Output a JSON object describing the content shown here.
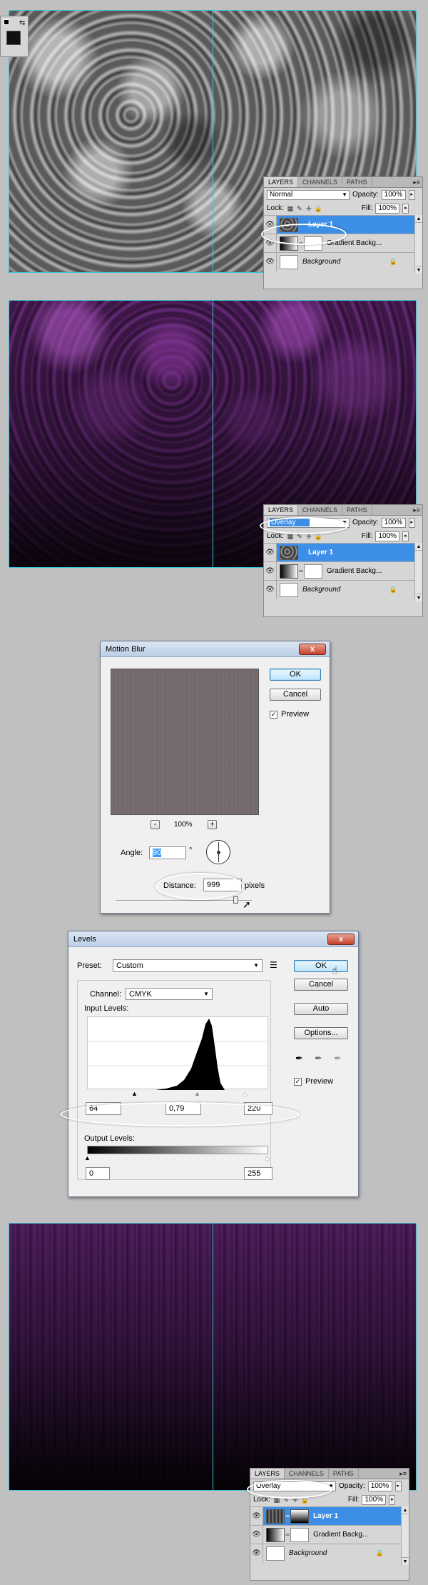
{
  "panels": [
    {
      "tabs": [
        "LAYERS",
        "CHANNELS",
        "PATHS"
      ],
      "blend_mode": "Normal",
      "opacity_label": "Opacity:",
      "opacity": "100%",
      "lock_label": "Lock:",
      "fill_label": "Fill:",
      "fill": "100%",
      "layers": [
        "Layer 1",
        "Gradient Backg...",
        "Background"
      ]
    },
    {
      "tabs": [
        "LAYERS",
        "CHANNELS",
        "PATHS"
      ],
      "blend_mode": "Overlay",
      "opacity_label": "Opacity:",
      "opacity": "100%",
      "lock_label": "Lock:",
      "fill_label": "Fill:",
      "fill": "100%",
      "layers": [
        "Layer 1",
        "Gradient Backg...",
        "Background"
      ]
    },
    {
      "tabs": [
        "LAYERS",
        "CHANNELS",
        "PATHS"
      ],
      "blend_mode": "Overlay",
      "opacity_label": "Opacity:",
      "opacity": "100%",
      "lock_label": "Lock:",
      "fill_label": "Fill:",
      "fill": "100%",
      "layers": [
        "Layer 1",
        "Gradient Backg...",
        "Background"
      ]
    }
  ],
  "motion_blur": {
    "title": "Motion Blur",
    "close": "x",
    "ok": "OK",
    "cancel": "Cancel",
    "preview_label": "Preview",
    "zoom_minus": "-",
    "zoom": "100%",
    "zoom_plus": "+",
    "angle_label": "Angle:",
    "angle_value": "90",
    "angle_unit": "°",
    "distance_label": "Distance:",
    "distance_value": "999",
    "distance_unit": "pixels"
  },
  "levels": {
    "title": "Levels",
    "close": "x",
    "preset_label": "Preset:",
    "preset_value": "Custom",
    "channel_label": "Channel:",
    "channel_value": "CMYK",
    "input_label": "Input Levels:",
    "input_black": "64",
    "input_gamma": "0,79",
    "input_white": "220",
    "output_label": "Output Levels:",
    "output_black": "0",
    "output_white": "255",
    "ok": "OK",
    "cancel": "Cancel",
    "auto": "Auto",
    "options": "Options...",
    "preview_label": "Preview"
  }
}
